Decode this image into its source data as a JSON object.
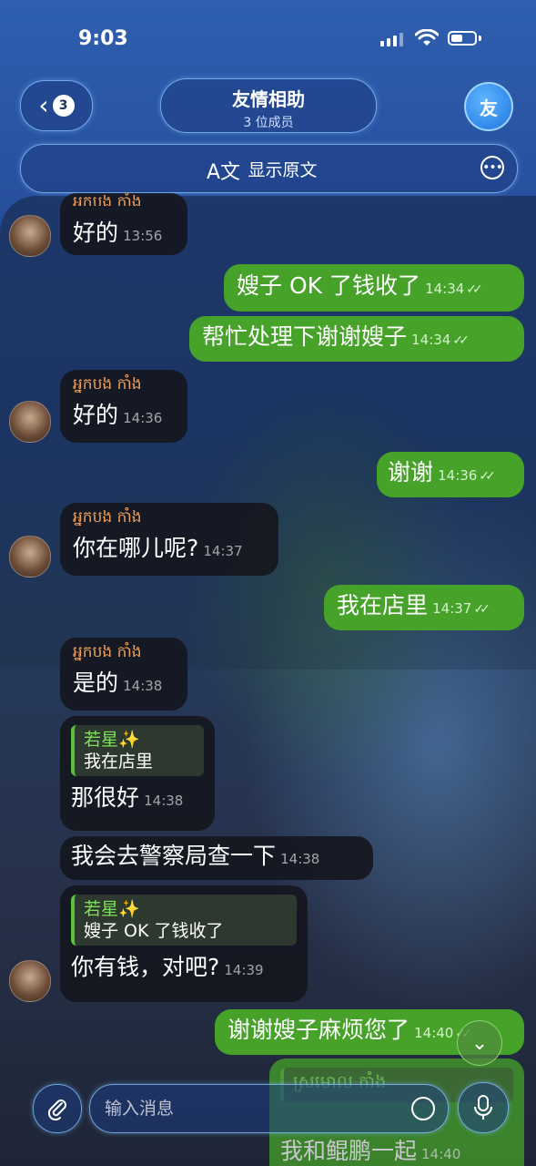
{
  "status": {
    "time": "9:03"
  },
  "header": {
    "back_count": "3",
    "title": "友情相助",
    "subtitle": "3 位成员",
    "avatar_letter": "友"
  },
  "translate_bar": {
    "icon_text": "A文",
    "label": "显示原文"
  },
  "messages": [
    {
      "sender": "អ្នកបង កាំង",
      "text": "好的",
      "time": "13:56"
    },
    {
      "text": "嫂子 OK 了钱收了",
      "time": "14:34"
    },
    {
      "text": "帮忙处理下谢谢嫂子",
      "time": "14:34"
    },
    {
      "sender": "អ្នកបង កាំង",
      "text": "好的",
      "time": "14:36"
    },
    {
      "text": "谢谢",
      "time": "14:36"
    },
    {
      "sender": "អ្នកបង កាំង",
      "text": "你在哪儿呢?",
      "time": "14:37"
    },
    {
      "text": "我在店里",
      "time": "14:37"
    },
    {
      "sender": "អ្នកបង កាំង",
      "text": "是的",
      "time": "14:38"
    },
    {
      "reply_name": "若星✨",
      "reply_text": "我在店里",
      "text": "那很好",
      "time": "14:38"
    },
    {
      "text": "我会去警察局查一下",
      "time": "14:38"
    },
    {
      "reply_name": "若星✨",
      "reply_text": "嫂子 OK 了钱收了",
      "text": "你有钱，对吧?",
      "time": "14:39"
    },
    {
      "text": "谢谢嫂子麻烦您了",
      "time": "14:40"
    },
    {
      "reply_name": "ស្រមោល កាំង",
      "text": "我和鲲鹏一起",
      "time": "14:40"
    }
  ],
  "input": {
    "placeholder": "输入消息"
  },
  "icons": {
    "attach": "paperclip-icon",
    "mic": "microphone-icon",
    "sticker": "sticker-icon",
    "scroll": "chevron-down-icon",
    "read": "double-check-icon"
  }
}
